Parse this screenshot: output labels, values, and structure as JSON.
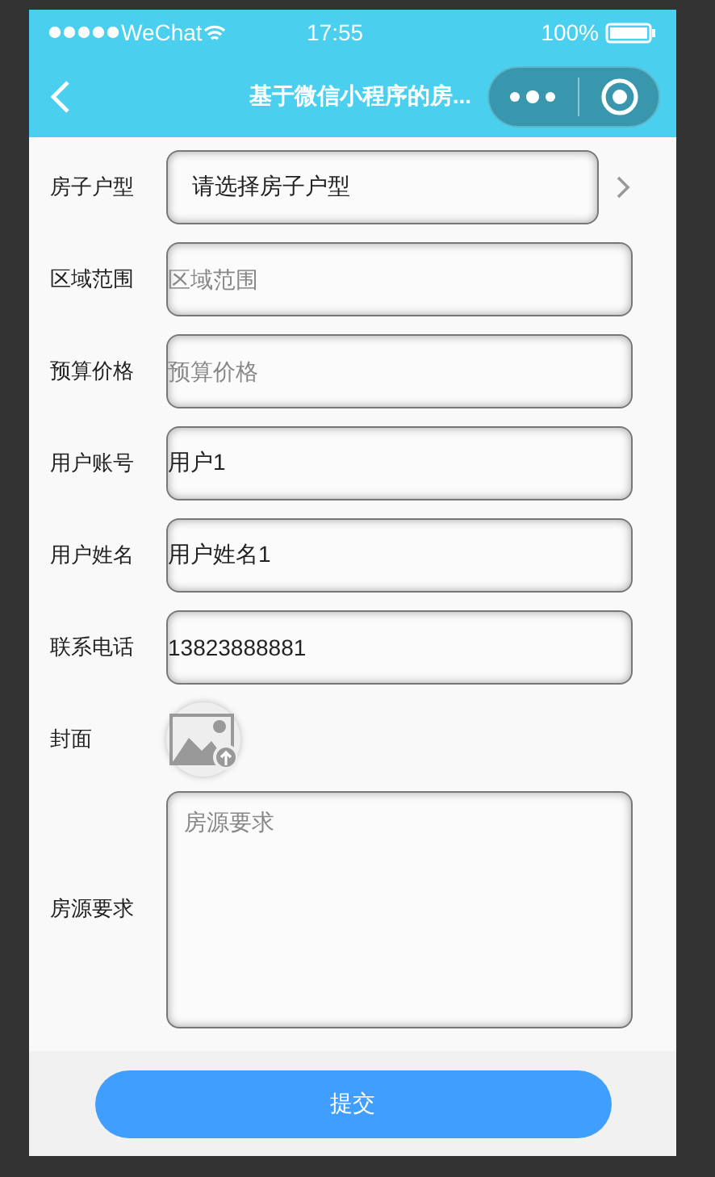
{
  "status_bar": {
    "carrier": "WeChat",
    "time": "17:55",
    "battery": "100%"
  },
  "nav": {
    "title": "基于微信小程序的房..."
  },
  "form": [
    {
      "kind": "select",
      "label": "房子户型",
      "value": "请选择房子户型"
    },
    {
      "kind": "text",
      "label": "区域范围",
      "placeholder": "区域范围"
    },
    {
      "kind": "text",
      "label": "预算价格",
      "placeholder": "预算价格"
    },
    {
      "kind": "text",
      "label": "用户账号",
      "value": "用户1"
    },
    {
      "kind": "text",
      "label": "用户姓名",
      "value": "用户姓名1"
    },
    {
      "kind": "text",
      "label": "联系电话",
      "value": "13823888881"
    },
    {
      "kind": "image",
      "label": "封面"
    },
    {
      "kind": "textarea",
      "label": "房源要求",
      "placeholder": "房源要求"
    }
  ],
  "submit": "提交"
}
